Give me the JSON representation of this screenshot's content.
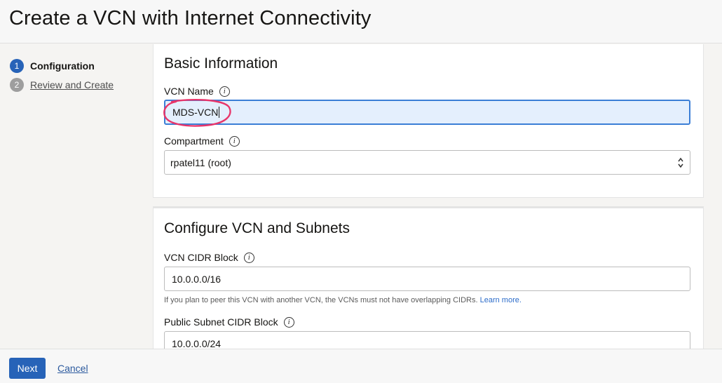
{
  "page": {
    "title": "Create a VCN with Internet Connectivity"
  },
  "steps": [
    {
      "num": "1",
      "label": "Configuration"
    },
    {
      "num": "2",
      "label": "Review and Create"
    }
  ],
  "basic": {
    "heading": "Basic Information",
    "vcn_name_label": "VCN Name",
    "vcn_name_value": "MDS-VCN",
    "compartment_label": "Compartment",
    "compartment_value": "rpatel11 (root)"
  },
  "configure": {
    "heading": "Configure VCN and Subnets",
    "vcn_cidr_label": "VCN CIDR Block",
    "vcn_cidr_value": "10.0.0.0/16",
    "helper_text": "If you plan to peer this VCN with another VCN, the VCNs must not have overlapping CIDRs.",
    "learn_more": "Learn more.",
    "public_subnet_label": "Public Subnet CIDR Block",
    "public_subnet_value": "10.0.0.0/24"
  },
  "footer": {
    "next_label": "Next",
    "cancel_label": "Cancel"
  },
  "icons": {
    "info": "i"
  },
  "colors": {
    "accent": "#2763b8",
    "annotation": "#e8356a"
  }
}
